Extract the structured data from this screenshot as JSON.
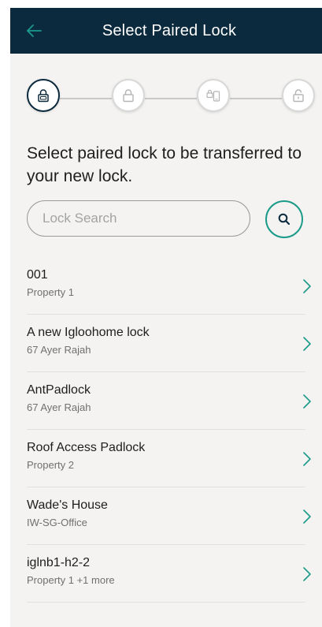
{
  "header": {
    "title": "Select Paired Lock",
    "back_icon": "arrow-left-icon",
    "background": "#0c2a3e",
    "icon_color": "#1a9b8a"
  },
  "stepper": {
    "steps": [
      {
        "icon": "lock-keypad-icon",
        "active": true
      },
      {
        "icon": "lock-icon",
        "active": false
      },
      {
        "icon": "phone-lock-icon",
        "active": false
      },
      {
        "icon": "lock-open-icon",
        "active": false
      }
    ]
  },
  "instruction": "Select paired lock to be transferred to your new lock.",
  "search": {
    "placeholder": "Lock Search",
    "value": "",
    "button_icon": "search-icon",
    "accent": "#1a9b8a"
  },
  "locks": [
    {
      "name": "001",
      "location": "Property 1"
    },
    {
      "name": "A new Igloohome lock",
      "location": "67 Ayer Rajah"
    },
    {
      "name": "AntPadlock",
      "location": "67 Ayer Rajah"
    },
    {
      "name": "Roof Access Padlock",
      "location": "Property 2"
    },
    {
      "name": "Wade's House",
      "location": "IW-SG-Office"
    },
    {
      "name": "iglnb1-h2-2",
      "location": "Property 1 +1 more"
    }
  ]
}
